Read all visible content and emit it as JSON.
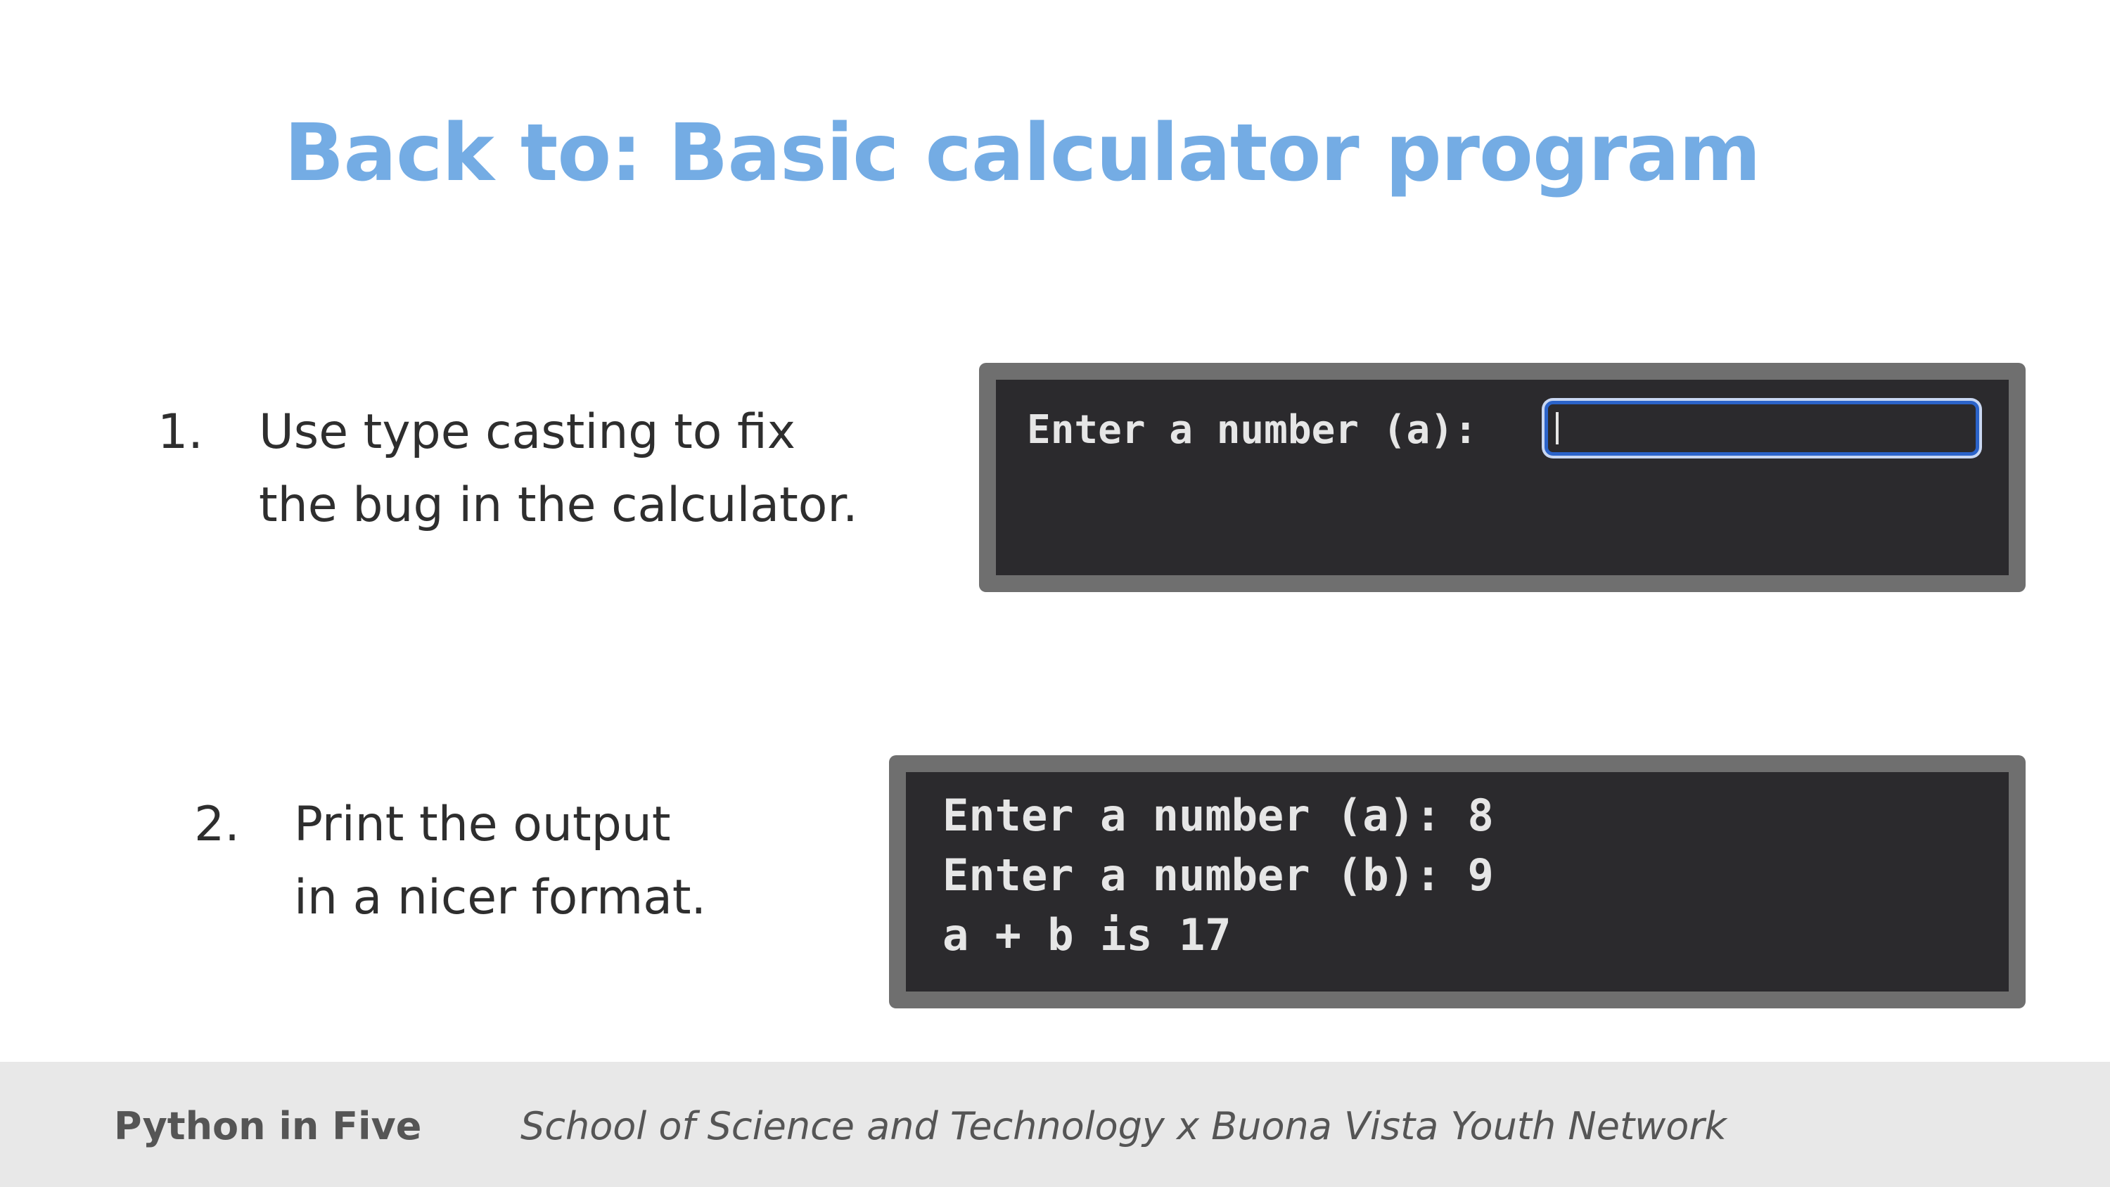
{
  "slide": {
    "title": "Back to: Basic calculator program"
  },
  "steps": [
    {
      "number": "1.",
      "lines": [
        "Use type casting to fix",
        "the bug in the calculator."
      ]
    },
    {
      "number": "2.",
      "lines": [
        "Print the output",
        "in a nicer format."
      ]
    }
  ],
  "terminal_input": {
    "prompt": "Enter a number (a):",
    "value": ""
  },
  "terminal_output": {
    "lines": [
      "Enter a number (a): 8",
      "Enter a number (b): 9",
      "a + b is 17"
    ]
  },
  "footer": {
    "course": "Python in Five",
    "organization": "School of Science and Technology x Buona Vista Youth Network"
  },
  "colors": {
    "title": "#74ace4",
    "terminal_background": "#2b2a2d",
    "terminal_frame": "#6f6f6f",
    "input_focus_border": "#2b63c9",
    "footer_background": "#e8e8e8"
  }
}
